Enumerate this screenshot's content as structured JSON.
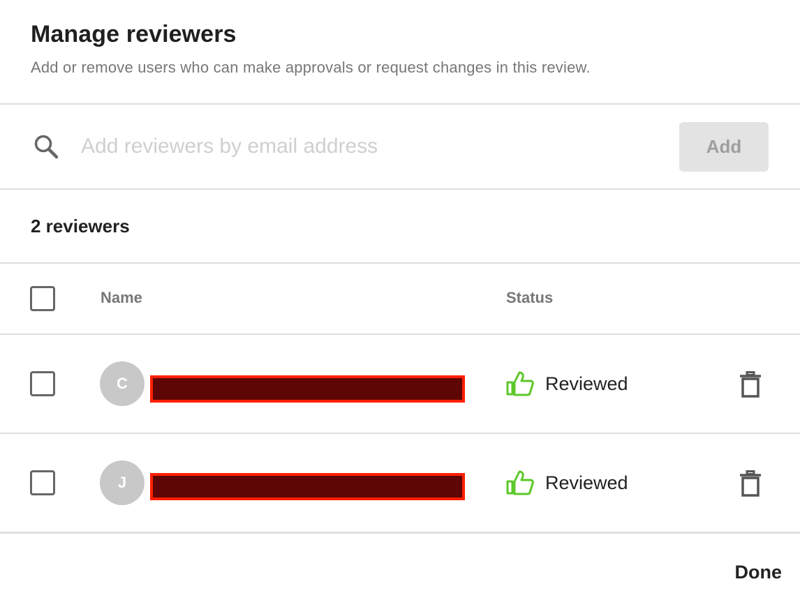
{
  "dialog": {
    "title": "Manage reviewers",
    "subtitle": "Add or remove users who can make approvals or request changes in this review."
  },
  "search": {
    "icon": "search-icon",
    "placeholder": "Add reviewers by email address",
    "value": "",
    "add_label": "Add"
  },
  "reviewers": {
    "count_label": "2 reviewers",
    "columns": {
      "name": "Name",
      "status": "Status"
    },
    "rows": [
      {
        "initial": "C",
        "name": "[redacted]",
        "status": "Reviewed",
        "status_icon": "thumbs-up-icon",
        "delete_icon": "trash-icon"
      },
      {
        "initial": "J",
        "name": "[redacted]",
        "status": "Reviewed",
        "status_icon": "thumbs-up-icon",
        "delete_icon": "trash-icon"
      }
    ]
  },
  "footer": {
    "done_label": "Done"
  },
  "colors": {
    "reviewed_green": "#5cc72a",
    "redaction_fill": "#5e0505",
    "redaction_border": "#ff1f00",
    "avatar_gray": "#c8c8c8"
  }
}
